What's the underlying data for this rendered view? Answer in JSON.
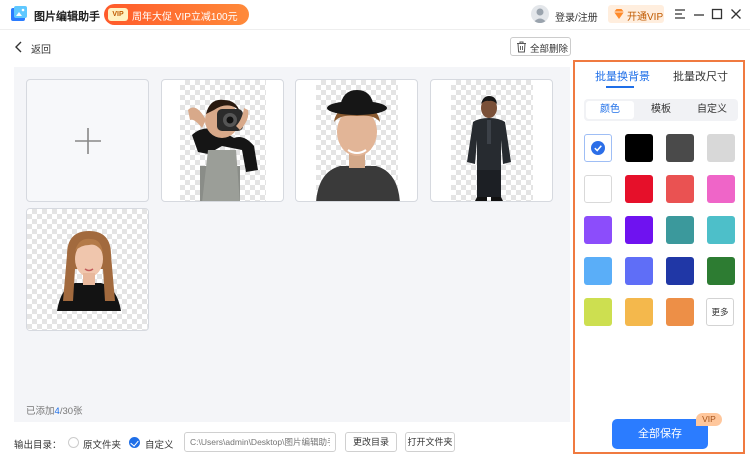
{
  "titlebar": {
    "app_title": "图片编辑助手",
    "promo_badge": "VIP",
    "promo_text": "周年大促 VIP立减100元",
    "login_text": "登录/注册",
    "vip_open": "开通VIP",
    "icons": [
      "menu-icon",
      "minimize-icon",
      "maximize-icon",
      "close-icon"
    ]
  },
  "toolbar": {
    "back_label": "返回",
    "delete_all_label": "全部删除"
  },
  "images": {
    "count_prefix": "已添加",
    "count_current": "4",
    "count_total": "/30张"
  },
  "panel": {
    "tabs": [
      "批量换背景",
      "批量改尺寸"
    ],
    "active_tab": 0,
    "subtabs": [
      "颜色",
      "模板",
      "自定义"
    ],
    "active_subtab": 0,
    "colors": [
      "#ffffff",
      "#000000",
      "#4a4a4a",
      "#d8d8d8",
      "#ffffff",
      "#e6102a",
      "#ea5252",
      "#ef65c8",
      "#8c4dfb",
      "#6f12f0",
      "#3b999c",
      "#4dbfc9",
      "#5aaef8",
      "#5f6ef7",
      "#2037a6",
      "#2d7c32",
      "#cddf50",
      "#f4b84c",
      "#ed8f47"
    ],
    "selected_color": 0,
    "more_label": "更多",
    "save_label": "全部保存",
    "vip_tag": "VIP"
  },
  "output": {
    "label": "输出目录：",
    "option_original": "原文件夹",
    "option_custom": "自定义",
    "selected": "custom",
    "path_placeholder": "C:\\Users\\admin\\Desktop\\图片编辑助手",
    "change_dir_label": "更改目录",
    "open_folder_label": "打开文件夹"
  },
  "accent_color": "#1f6fe8",
  "highlight_color": "#f07a40"
}
